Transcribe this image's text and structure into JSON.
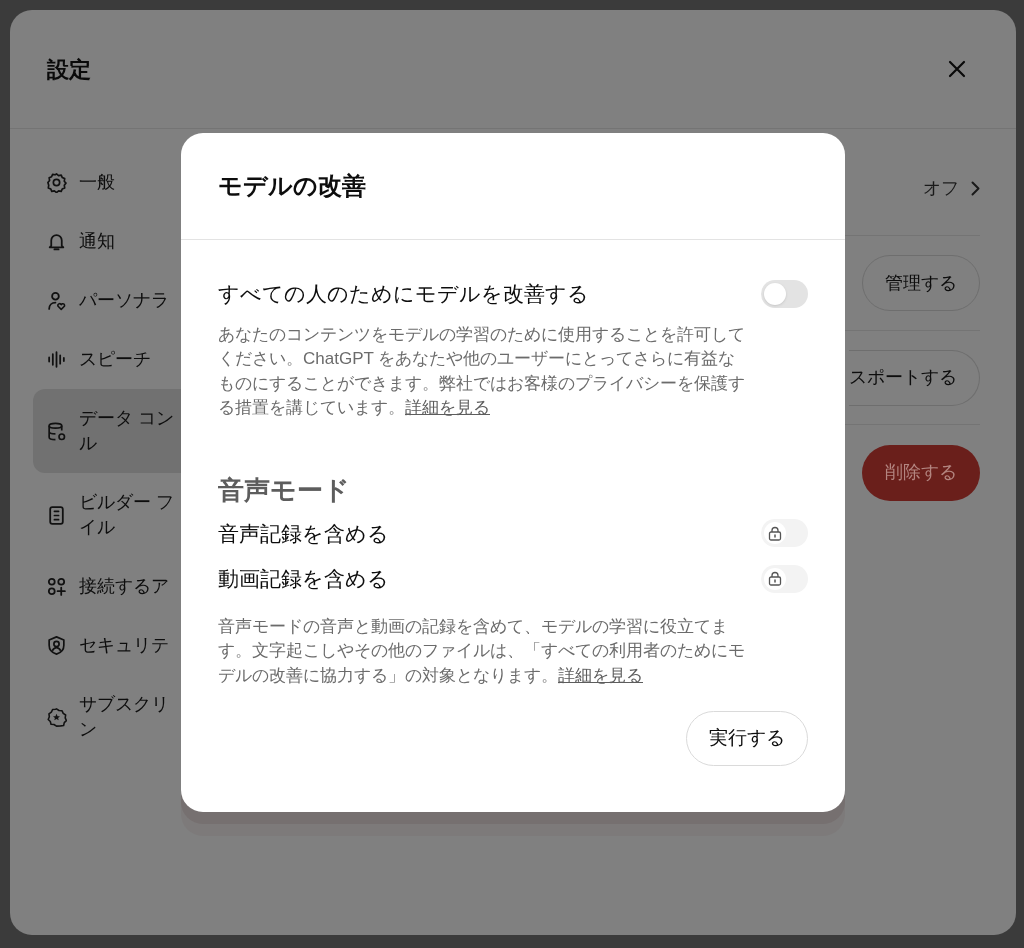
{
  "settings": {
    "title": "設定",
    "sidebar": {
      "items": [
        {
          "lines": [
            "一般"
          ],
          "selected": false
        },
        {
          "lines": [
            "通知"
          ],
          "selected": false
        },
        {
          "lines": [
            "パーソナラ"
          ],
          "selected": false
        },
        {
          "lines": [
            "スピーチ"
          ],
          "selected": false
        },
        {
          "lines": [
            "データ コン",
            "ル"
          ],
          "selected": true
        },
        {
          "lines": [
            "ビルダー フ",
            "イル"
          ],
          "selected": false
        },
        {
          "lines": [
            "接続するア"
          ],
          "selected": false
        },
        {
          "lines": [
            "セキュリテ"
          ],
          "selected": false
        },
        {
          "lines": [
            "サブスクリ",
            "ン"
          ],
          "selected": false
        }
      ]
    },
    "rows": [
      {
        "kind": "value",
        "text": "オフ"
      },
      {
        "kind": "button",
        "text": "管理する"
      },
      {
        "kind": "button_cut",
        "text": "スポートする"
      },
      {
        "kind": "danger_button",
        "text": "削除する"
      }
    ]
  },
  "dialog": {
    "title": "モデルの改善",
    "main_toggle": {
      "label": "すべての人のためにモデルを改善する",
      "checked": false,
      "disabled": false
    },
    "description": {
      "text": "あなたのコンテンツをモデルの学習のために使用することを許可してください。ChatGPT をあなたや他のユーザーにとってさらに有益なものにすることができます。弊社ではお客様のプライバシーを保護する措置を講じています。",
      "link": "詳細を見る"
    },
    "section_title": "音声モード",
    "voice_toggles": [
      {
        "label": "音声記録を含める",
        "checked": false,
        "disabled": true
      },
      {
        "label": "動画記録を含める",
        "checked": false,
        "disabled": true
      }
    ],
    "voice_description": {
      "text": "音声モードの音声と動画の記録を含めて、モデルの学習に役立てます。文字起こしやその他のファイルは、「すべての利用者のためにモデルの改善に協力する」の対象となります。",
      "link": "詳細を見る"
    },
    "button": "実行する"
  }
}
